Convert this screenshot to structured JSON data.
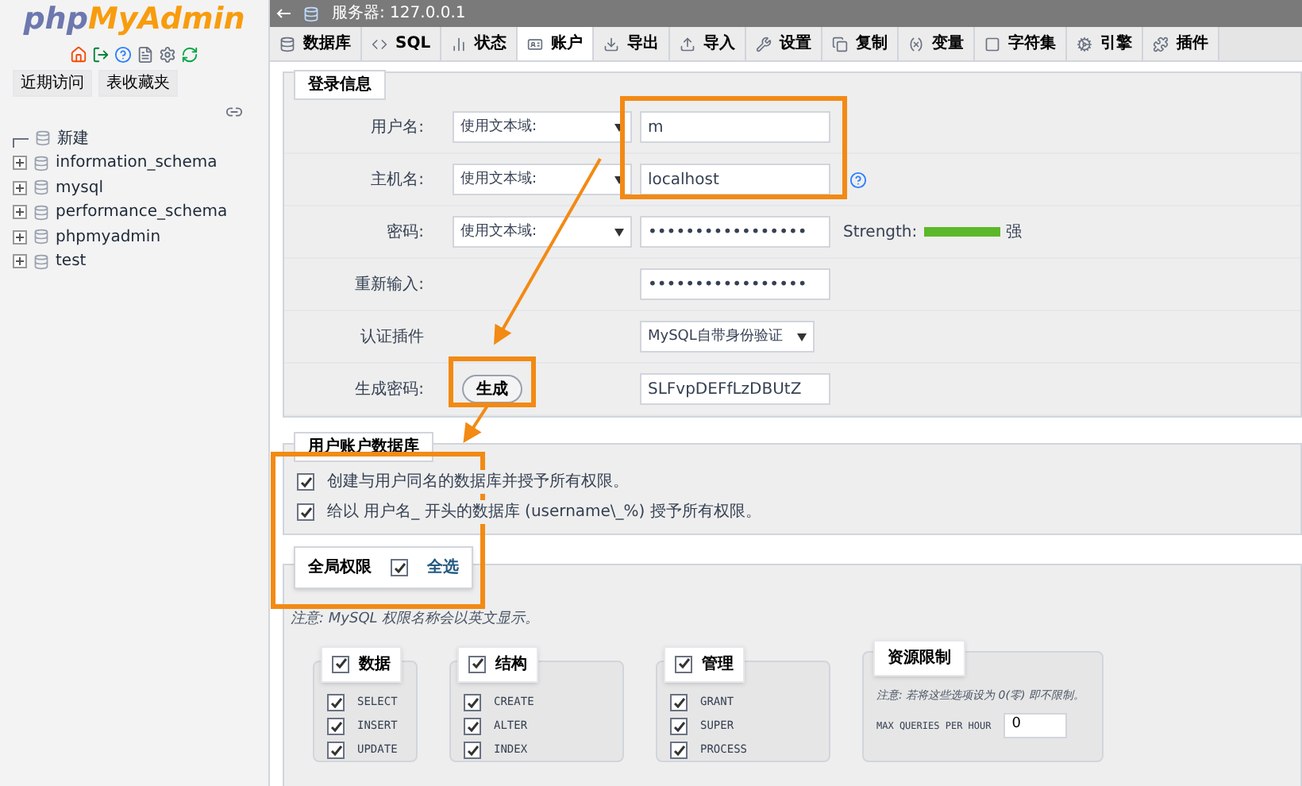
{
  "sidebar": {
    "logo": {
      "php": "php",
      "myadmin": "MyAdmin"
    },
    "tabs": [
      "近期访问",
      "表收藏夹"
    ],
    "tree": [
      {
        "label": "新建",
        "kind": "new"
      },
      {
        "label": "information_schema",
        "kind": "db"
      },
      {
        "label": "mysql",
        "kind": "db"
      },
      {
        "label": "performance_schema",
        "kind": "db"
      },
      {
        "label": "phpmyadmin",
        "kind": "db"
      },
      {
        "label": "test",
        "kind": "db"
      }
    ]
  },
  "server_bar": {
    "title": "服务器: 127.0.0.1"
  },
  "tabs": [
    {
      "label": "数据库",
      "selected": false
    },
    {
      "label": "SQL",
      "selected": false
    },
    {
      "label": "状态",
      "selected": false
    },
    {
      "label": "账户",
      "selected": true
    },
    {
      "label": "导出",
      "selected": false
    },
    {
      "label": "导入",
      "selected": false
    },
    {
      "label": "设置",
      "selected": false
    },
    {
      "label": "复制",
      "selected": false
    },
    {
      "label": "变量",
      "selected": false
    },
    {
      "label": "字符集",
      "selected": false
    },
    {
      "label": "引擎",
      "selected": false
    },
    {
      "label": "插件",
      "selected": false
    }
  ],
  "login_info": {
    "legend": "登录信息",
    "rows": [
      {
        "kind": "text",
        "label": "用户名:",
        "select": "使用文本域:",
        "value": "m"
      },
      {
        "kind": "host",
        "label": "主机名:",
        "select": "使用文本域:",
        "value": "localhost"
      },
      {
        "kind": "password",
        "label": "密码:",
        "select": "使用文本域:",
        "value": "•••••••••••••••••",
        "strength_label": "Strength:",
        "level": 1,
        "strength_text": "强"
      },
      {
        "kind": "retype",
        "label": "重新输入:",
        "value": "•••••••••••••••••"
      },
      {
        "kind": "plugin",
        "label": "认证插件",
        "select": "MySQL自带身份验证"
      },
      {
        "kind": "generate",
        "label": "生成密码:",
        "button": "生成",
        "value": "SLFvpDEFfLzDBUtZ"
      }
    ]
  },
  "user_database": {
    "legend": "用户账户数据库",
    "options": [
      {
        "text": "创建与用户同名的数据库并授予所有权限。",
        "checked": true
      },
      {
        "text": "给以 用户名_ 开头的数据库 (username\\_%) 授予所有权限。",
        "checked": true
      }
    ]
  },
  "global_privileges": {
    "legend": "全局权限",
    "select_all": {
      "label": "全选",
      "checked": true
    },
    "note": "注意: MySQL 权限名称会以英文显示。",
    "groups": [
      {
        "title": "数据",
        "checked": true,
        "items": [
          {
            "name": "SELECT",
            "checked": true
          },
          {
            "name": "INSERT",
            "checked": true
          },
          {
            "name": "UPDATE",
            "checked": true
          }
        ]
      },
      {
        "title": "结构",
        "checked": true,
        "items": [
          {
            "name": "CREATE",
            "checked": true
          },
          {
            "name": "ALTER",
            "checked": true
          },
          {
            "name": "INDEX",
            "checked": true
          }
        ]
      },
      {
        "title": "管理",
        "checked": true,
        "items": [
          {
            "name": "GRANT",
            "checked": true
          },
          {
            "name": "SUPER",
            "checked": true
          },
          {
            "name": "PROCESS",
            "checked": true
          }
        ]
      }
    ],
    "resource": {
      "legend": "资源限制",
      "note": "注意: 若将这些选项设为 0(零) 即不限制。",
      "fields": [
        {
          "label": "MAX QUERIES PER HOUR",
          "value": "0"
        }
      ]
    }
  }
}
